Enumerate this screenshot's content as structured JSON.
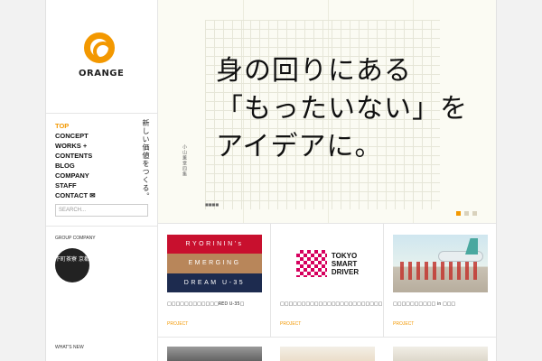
{
  "brand": {
    "logo_text": "ORANGE",
    "accent": "#f39800"
  },
  "nav": {
    "items": [
      {
        "label": "TOP",
        "active": true
      },
      {
        "label": "CONCEPT",
        "active": false
      },
      {
        "label": "WORKS +",
        "active": false
      },
      {
        "label": "CONTENTS",
        "active": false
      },
      {
        "label": "BLOG",
        "active": false
      },
      {
        "label": "COMPANY",
        "active": false
      },
      {
        "label": "STAFF",
        "active": false
      },
      {
        "label": "CONTACT ✉",
        "active": false
      }
    ],
    "tagline": "新しい価値をつくる。"
  },
  "search": {
    "placeholder": "SEARCH..."
  },
  "group": {
    "label": "GROUP COMPANY",
    "seal_text": "下町茶寮 京都"
  },
  "whats_new": {
    "label": "WHAT'S NEW"
  },
  "hero": {
    "line1": "身の回りにある",
    "line2": "「もったいない」を",
    "line3": "アイデアに。",
    "side_note": "小山薫堂四集",
    "bottom_note": "■■■■",
    "slide_count": 3,
    "active_slide": 1
  },
  "projects": [
    {
      "title_bands": [
        "RYORININ's",
        "EMERGING",
        "DREAM U-35"
      ],
      "caption": "□□□□□□□□□□□□RED U-35□",
      "tag": "PROJECT"
    },
    {
      "logo_text": [
        "TOKYO",
        "SMART",
        "DRIVER"
      ],
      "caption": "□□□□□□□□□□□□□□□□□□□□□□□□",
      "tag": "PROJECT"
    },
    {
      "caption": "□□□□□□□□□□ in □□□",
      "tag": "PROJECT"
    }
  ]
}
